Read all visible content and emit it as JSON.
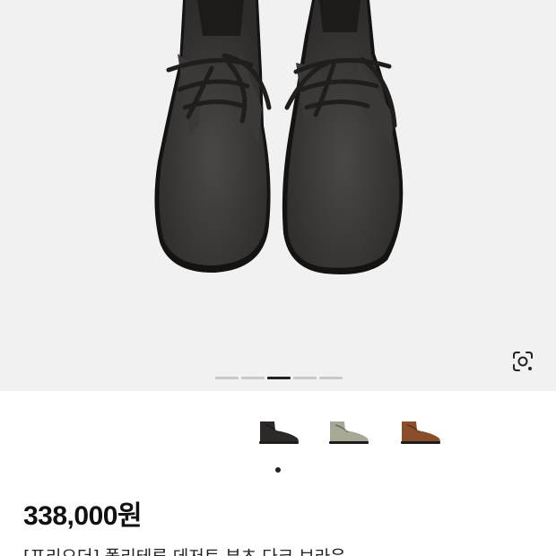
{
  "gallery": {
    "slide_count": 5,
    "active_slide": 3,
    "lens_icon": "visual-search-icon"
  },
  "variants": [
    {
      "name": "black",
      "color": "#2b2a29"
    },
    {
      "name": "grey",
      "color": "#a9a796"
    },
    {
      "name": "brown",
      "color": "#8a4e2a"
    }
  ],
  "product": {
    "price": "338,000원",
    "title": "[프리오더] 폴리테루 데저트 부츠 다크 브라운"
  }
}
